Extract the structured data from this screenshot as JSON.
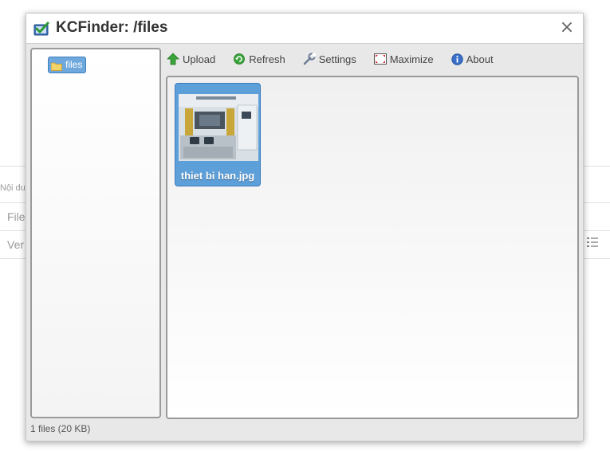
{
  "background": {
    "label_content": "Nội du",
    "label_file": "File",
    "label_ver": "Ver"
  },
  "dialog": {
    "title": "KCFinder: /files",
    "close_symbol": "×",
    "folders": [
      {
        "label": "files",
        "selected": true
      }
    ],
    "toolbar": {
      "upload": "Upload",
      "refresh": "Refresh",
      "settings": "Settings",
      "maximize": "Maximize",
      "about": "About"
    },
    "files": [
      {
        "name": "thiet bi han.jpg",
        "selected": true
      }
    ],
    "status": "1 files (20 KB)"
  },
  "colors": {
    "selection": "#5d9fd9",
    "upload_icon": "#3aa33a",
    "refresh_icon": "#2f9a3a",
    "about_icon": "#3a6fc8"
  }
}
